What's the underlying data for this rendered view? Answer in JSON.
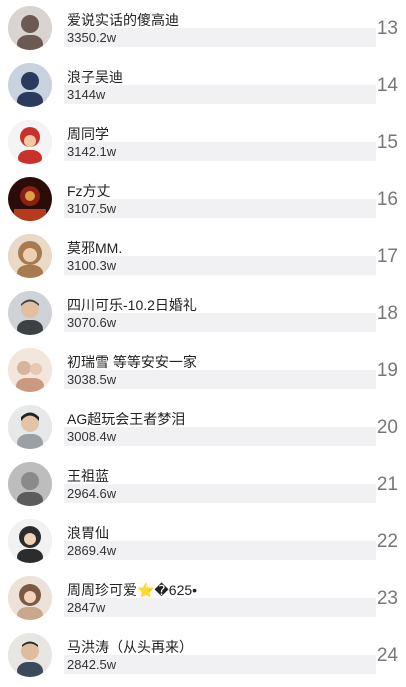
{
  "rows": [
    {
      "rank": "13",
      "name": "爱说实话的傻高迪",
      "value": "3350.2w",
      "avatar_icon": "user-avatar-icon",
      "avatar_color": "#6b5a52"
    },
    {
      "rank": "14",
      "name": "浪子吴迪",
      "value": "3144w",
      "avatar_icon": "user-avatar-icon",
      "avatar_color": "#2b3b5e"
    },
    {
      "rank": "15",
      "name": "周同学",
      "value": "3142.1w",
      "avatar_icon": "user-avatar-icon",
      "avatar_color": "#c8322b"
    },
    {
      "rank": "16",
      "name": "Fz方丈",
      "value": "3107.5w",
      "avatar_icon": "user-avatar-icon",
      "avatar_color": "#8a1f16"
    },
    {
      "rank": "17",
      "name": "莫邪MM.",
      "value": "3100.3w",
      "avatar_icon": "user-avatar-icon",
      "avatar_color": "#a87a4f"
    },
    {
      "rank": "18",
      "name": "四川可乐-10.2日婚礼",
      "value": "3070.6w",
      "avatar_icon": "user-avatar-icon",
      "avatar_color": "#3d4044"
    },
    {
      "rank": "19",
      "name": "初瑞雪 等等安安一家",
      "value": "3038.5w",
      "avatar_icon": "user-avatar-icon",
      "avatar_color": "#d8b49a"
    },
    {
      "rank": "20",
      "name": "AG超玩会王者梦泪",
      "value": "3008.4w",
      "avatar_icon": "user-avatar-icon",
      "avatar_color": "#9aa0a6"
    },
    {
      "rank": "21",
      "name": "王祖蓝",
      "value": "2964.6w",
      "avatar_icon": "user-avatar-icon",
      "avatar_color": "#5c5c5c"
    },
    {
      "rank": "22",
      "name": "浪胃仙",
      "value": "2869.4w",
      "avatar_icon": "user-avatar-icon",
      "avatar_color": "#2c2c2c"
    },
    {
      "rank": "23",
      "name": "周周珍可爱⭐️�625•",
      "value": "2847w",
      "avatar_icon": "user-avatar-icon",
      "avatar_color": "#c9a98c"
    },
    {
      "rank": "24",
      "name": "马洪涛（从头再来）",
      "value": "2842.5w",
      "avatar_icon": "user-avatar-icon",
      "avatar_color": "#3a4a5a"
    }
  ]
}
